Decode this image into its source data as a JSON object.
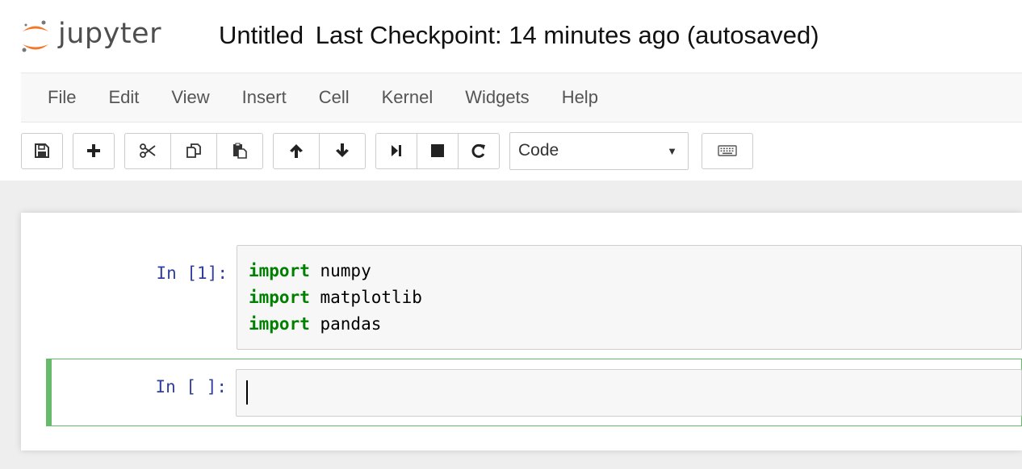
{
  "header": {
    "logo_text": "jupyter",
    "notebook_name": "Untitled",
    "checkpoint_status": "Last Checkpoint: 14 minutes ago (autosaved)"
  },
  "menubar": {
    "items": [
      {
        "label": "File"
      },
      {
        "label": "Edit"
      },
      {
        "label": "View"
      },
      {
        "label": "Insert"
      },
      {
        "label": "Cell"
      },
      {
        "label": "Kernel"
      },
      {
        "label": "Widgets"
      },
      {
        "label": "Help"
      }
    ]
  },
  "toolbar": {
    "cell_type_selected": "Code",
    "icons": {
      "save": "save-icon",
      "insert": "plus-icon",
      "cut": "scissors-icon",
      "copy": "copy-icon",
      "paste": "paste-icon",
      "move_up": "arrow-up-icon",
      "move_down": "arrow-down-icon",
      "run": "step-forward-icon",
      "interrupt": "stop-icon",
      "restart": "restart-icon",
      "command_palette": "keyboard-icon"
    }
  },
  "cells": [
    {
      "prompt": "In [1]:",
      "lines": [
        {
          "keyword": "import",
          "rest": " numpy"
        },
        {
          "keyword": "import",
          "rest": " matplotlib"
        },
        {
          "keyword": "import",
          "rest": " pandas"
        }
      ]
    },
    {
      "prompt": "In [ ]:",
      "lines": []
    }
  ],
  "colors": {
    "selected_cell_border": "#66bb6a",
    "prompt_color": "#303f9f",
    "keyword_color": "#008000",
    "logo_orange": "#f37726"
  }
}
